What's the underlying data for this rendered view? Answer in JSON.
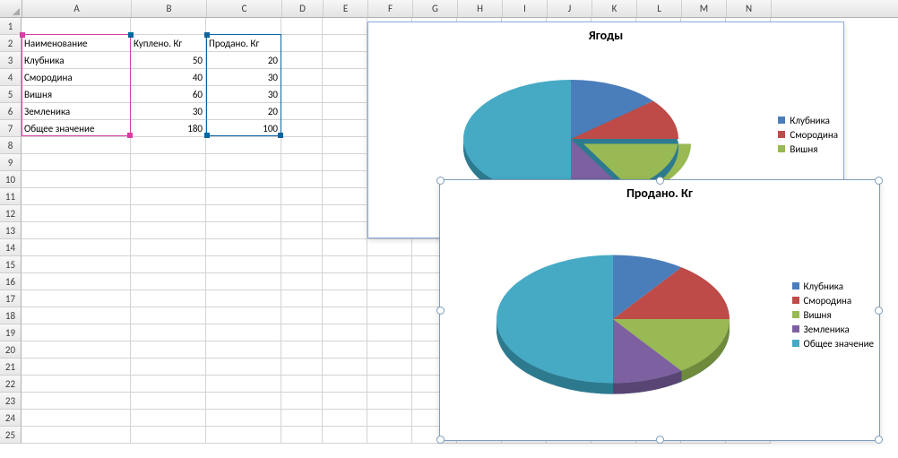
{
  "columns": [
    "A",
    "B",
    "C",
    "D",
    "E",
    "F",
    "G",
    "H",
    "I",
    "J",
    "K",
    "L",
    "M",
    "N"
  ],
  "row_count": 25,
  "table": {
    "headers": {
      "name": "Наименование",
      "bought": "Куплено. Кг",
      "sold": "Продано. Кг"
    },
    "rows": [
      {
        "name": "Клубника",
        "bought": "50",
        "sold": "20"
      },
      {
        "name": "Смородина",
        "bought": "40",
        "sold": "30"
      },
      {
        "name": "Вишня",
        "bought": "60",
        "sold": "30"
      },
      {
        "name": "Земленика",
        "bought": "30",
        "sold": "20"
      },
      {
        "name": "Общее значение",
        "bought": "180",
        "sold": "100"
      }
    ]
  },
  "colors": {
    "c0": "#4a7ebb",
    "c1": "#be4b48",
    "c2": "#98b954",
    "c3": "#7d60a0",
    "c4": "#46aac5"
  },
  "chart1": {
    "title": "Ягоды",
    "legend": [
      "Клубника",
      "Смородина",
      "Вишня"
    ]
  },
  "chart2": {
    "title": "Продано. Кг",
    "legend": [
      "Клубника",
      "Смородина",
      "Вишня",
      "Земленика",
      "Общее значение"
    ]
  },
  "chart_data": [
    {
      "type": "pie",
      "title": "Ягоды",
      "categories": [
        "Клубника",
        "Смородина",
        "Вишня",
        "Земленика",
        "Общее значение"
      ],
      "values": [
        50,
        40,
        60,
        30,
        180
      ]
    },
    {
      "type": "pie",
      "title": "Продано. Кг",
      "categories": [
        "Клубника",
        "Смородина",
        "Вишня",
        "Земленика",
        "Общее значение"
      ],
      "values": [
        20,
        30,
        30,
        20,
        100
      ]
    }
  ]
}
